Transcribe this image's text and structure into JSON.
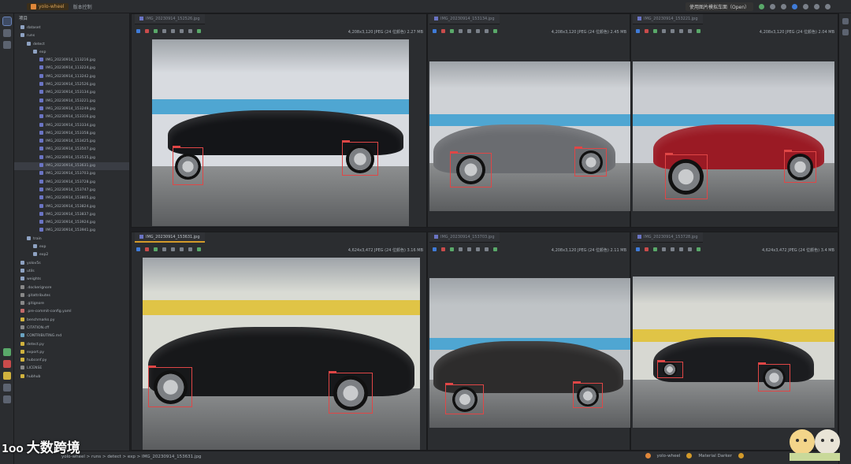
{
  "window": {
    "project": "yolo-wheel",
    "branch": "版本控制",
    "run_config": "使用图片模拟车面（Open）"
  },
  "sidebar": {
    "title": "项目",
    "rows": [
      {
        "l": "dataset",
        "t": "fold",
        "d": 0
      },
      {
        "l": "runs",
        "t": "fold",
        "d": 0
      },
      {
        "l": "detect",
        "t": "fold",
        "d": 1
      },
      {
        "l": "exp",
        "t": "fold",
        "d": 2
      },
      {
        "l": "IMG_20230914_113216.jpg",
        "t": "img",
        "d": 3
      },
      {
        "l": "IMG_20230914_113224.jpg",
        "t": "img",
        "d": 3
      },
      {
        "l": "IMG_20230914_113242.jpg",
        "t": "img",
        "d": 3
      },
      {
        "l": "IMG_20230914_152526.jpg",
        "t": "img",
        "d": 3
      },
      {
        "l": "IMG_20230914_153134.jpg",
        "t": "img",
        "d": 3
      },
      {
        "l": "IMG_20230914_153221.jpg",
        "t": "img",
        "d": 3
      },
      {
        "l": "IMG_20230914_153249.jpg",
        "t": "img",
        "d": 3
      },
      {
        "l": "IMG_20230914_153316.jpg",
        "t": "img",
        "d": 3
      },
      {
        "l": "IMG_20230914_153334.jpg",
        "t": "img",
        "d": 3
      },
      {
        "l": "IMG_20230914_153358.jpg",
        "t": "img",
        "d": 3
      },
      {
        "l": "IMG_20230914_153425.jpg",
        "t": "img",
        "d": 3
      },
      {
        "l": "IMG_20230914_153507.jpg",
        "t": "img",
        "d": 3
      },
      {
        "l": "IMG_20230914_153535.jpg",
        "t": "img",
        "d": 3
      },
      {
        "l": "IMG_20230914_153631.jpg",
        "t": "img",
        "d": 3,
        "sel": true
      },
      {
        "l": "IMG_20230914_153703.jpg",
        "t": "img",
        "d": 3
      },
      {
        "l": "IMG_20230914_153728.jpg",
        "t": "img",
        "d": 3
      },
      {
        "l": "IMG_20230914_153747.jpg",
        "t": "img",
        "d": 3
      },
      {
        "l": "IMG_20230914_153805.jpg",
        "t": "img",
        "d": 3
      },
      {
        "l": "IMG_20230914_153824.jpg",
        "t": "img",
        "d": 3
      },
      {
        "l": "IMG_20230914_153837.jpg",
        "t": "img",
        "d": 3
      },
      {
        "l": "IMG_20230914_153924.jpg",
        "t": "img",
        "d": 3
      },
      {
        "l": "IMG_20230914_153941.jpg",
        "t": "img",
        "d": 3
      },
      {
        "l": "train",
        "t": "fold",
        "d": 1
      },
      {
        "l": "exp",
        "t": "fold",
        "d": 2
      },
      {
        "l": "exp2",
        "t": "fold",
        "d": 2
      },
      {
        "l": "yolov5s",
        "t": "fold",
        "d": 0
      },
      {
        "l": "utils",
        "t": "fold",
        "d": 0
      },
      {
        "l": "weights",
        "t": "fold",
        "d": 0
      },
      {
        "l": ".dockerignore",
        "t": "txt",
        "d": 0
      },
      {
        "l": ".gitattributes",
        "t": "txt",
        "d": 0
      },
      {
        "l": ".gitignore",
        "t": "txt",
        "d": 0
      },
      {
        "l": ".pre-commit-config.yaml",
        "t": "yml",
        "d": 0
      },
      {
        "l": "benchmarks.py",
        "t": "py",
        "d": 0
      },
      {
        "l": "CITATION.cff",
        "t": "txt",
        "d": 0
      },
      {
        "l": "CONTRIBUTING.md",
        "t": "md",
        "d": 0
      },
      {
        "l": "detect.py",
        "t": "py",
        "d": 0
      },
      {
        "l": "export.py",
        "t": "py",
        "d": 0
      },
      {
        "l": "hubconf.py",
        "t": "py",
        "d": 0
      },
      {
        "l": "LICENSE",
        "t": "txt",
        "d": 0
      },
      {
        "l": "hubhub",
        "t": "py",
        "d": 0
      }
    ]
  },
  "panes": [
    {
      "tab": "IMG_20230914_152526.jpg",
      "active": false,
      "meta": "4,208x3,120 JPEG (24 位颜色) 2.27 MB"
    },
    {
      "tab": "IMG_20230914_153134.jpg",
      "active": false,
      "meta": "4,208x3,120 JPEG (24 位颜色) 2.45 MB"
    },
    {
      "tab": "IMG_20230914_153221.jpg",
      "active": false,
      "meta": "4,208x3,120 JPEG (24 位颜色) 2.04 MB"
    },
    {
      "tab": "IMG_20230914_153631.jpg",
      "active": true,
      "meta": "4,624x3,472 JPEG (24 位颜色) 3.16 MB"
    },
    {
      "tab": "IMG_20230914_153703.jpg",
      "active": false,
      "meta": "4,208x3,120 JPEG (24 位颜色) 2.11 MB"
    },
    {
      "tab": "IMG_20230914_153728.jpg",
      "active": false,
      "meta": "4,624x3,472 JPEG (24 位颜色) 3.4 MB"
    }
  ],
  "status": {
    "path": "yolo-wheel > runs > detect > exp > IMG_20230914_153631.jpg",
    "interp": "yolo-wheel",
    "theme": "Material Darker"
  },
  "watermark": "大数跨境",
  "colors": {
    "accent": "#d39a2a",
    "bbox": "#e04646",
    "wall_blue": "#4fa6d2",
    "wall_yellow": "#e0c446"
  }
}
